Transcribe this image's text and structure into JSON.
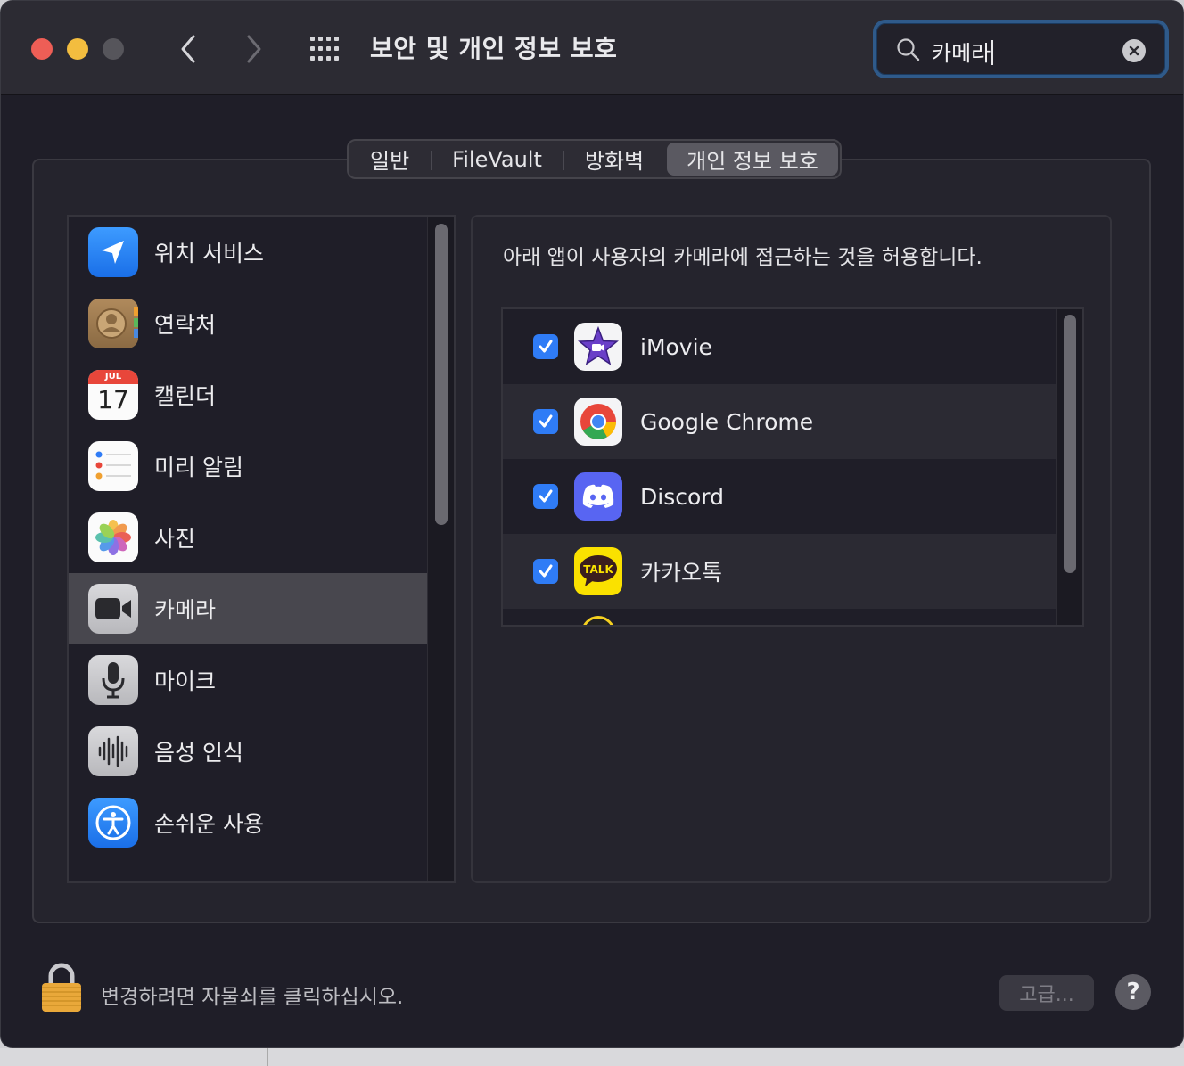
{
  "window": {
    "title": "보안 및 개인 정보 보호"
  },
  "search": {
    "value": "카메라"
  },
  "tabs": [
    {
      "label": "일반"
    },
    {
      "label": "FileVault"
    },
    {
      "label": "방화벽"
    },
    {
      "label": "개인 정보 보호",
      "active": true
    }
  ],
  "sidebar": {
    "items": [
      {
        "label": "위치 서비스",
        "icon": "location-icon"
      },
      {
        "label": "연락처",
        "icon": "contacts-icon"
      },
      {
        "label": "캘린더",
        "icon": "calendar-icon",
        "calendar_month": "JUL",
        "calendar_day": "17"
      },
      {
        "label": "미리 알림",
        "icon": "reminders-icon"
      },
      {
        "label": "사진",
        "icon": "photos-icon"
      },
      {
        "label": "카메라",
        "icon": "camera-icon",
        "selected": true
      },
      {
        "label": "마이크",
        "icon": "microphone-icon"
      },
      {
        "label": "음성 인식",
        "icon": "speech-recognition-icon"
      },
      {
        "label": "손쉬운 사용",
        "icon": "accessibility-icon"
      }
    ]
  },
  "content": {
    "description": "아래 앱이 사용자의 카메라에 접근하는 것을 허용합니다.",
    "apps": [
      {
        "name": "iMovie",
        "checked": true,
        "icon": "imovie-icon"
      },
      {
        "name": "Google Chrome",
        "checked": true,
        "icon": "chrome-icon"
      },
      {
        "name": "Discord",
        "checked": true,
        "icon": "discord-icon"
      },
      {
        "name": "카카오톡",
        "checked": true,
        "icon": "kakaotalk-icon",
        "icon_text": "TALK"
      }
    ]
  },
  "footer": {
    "lock_text": "변경하려면 자물쇠를 클릭하십시오.",
    "advanced_label": "고급...",
    "help_label": "?"
  },
  "colors": {
    "accent": "#2f7cf6",
    "background": "#1f1e28",
    "selected_row": "#48474e"
  }
}
